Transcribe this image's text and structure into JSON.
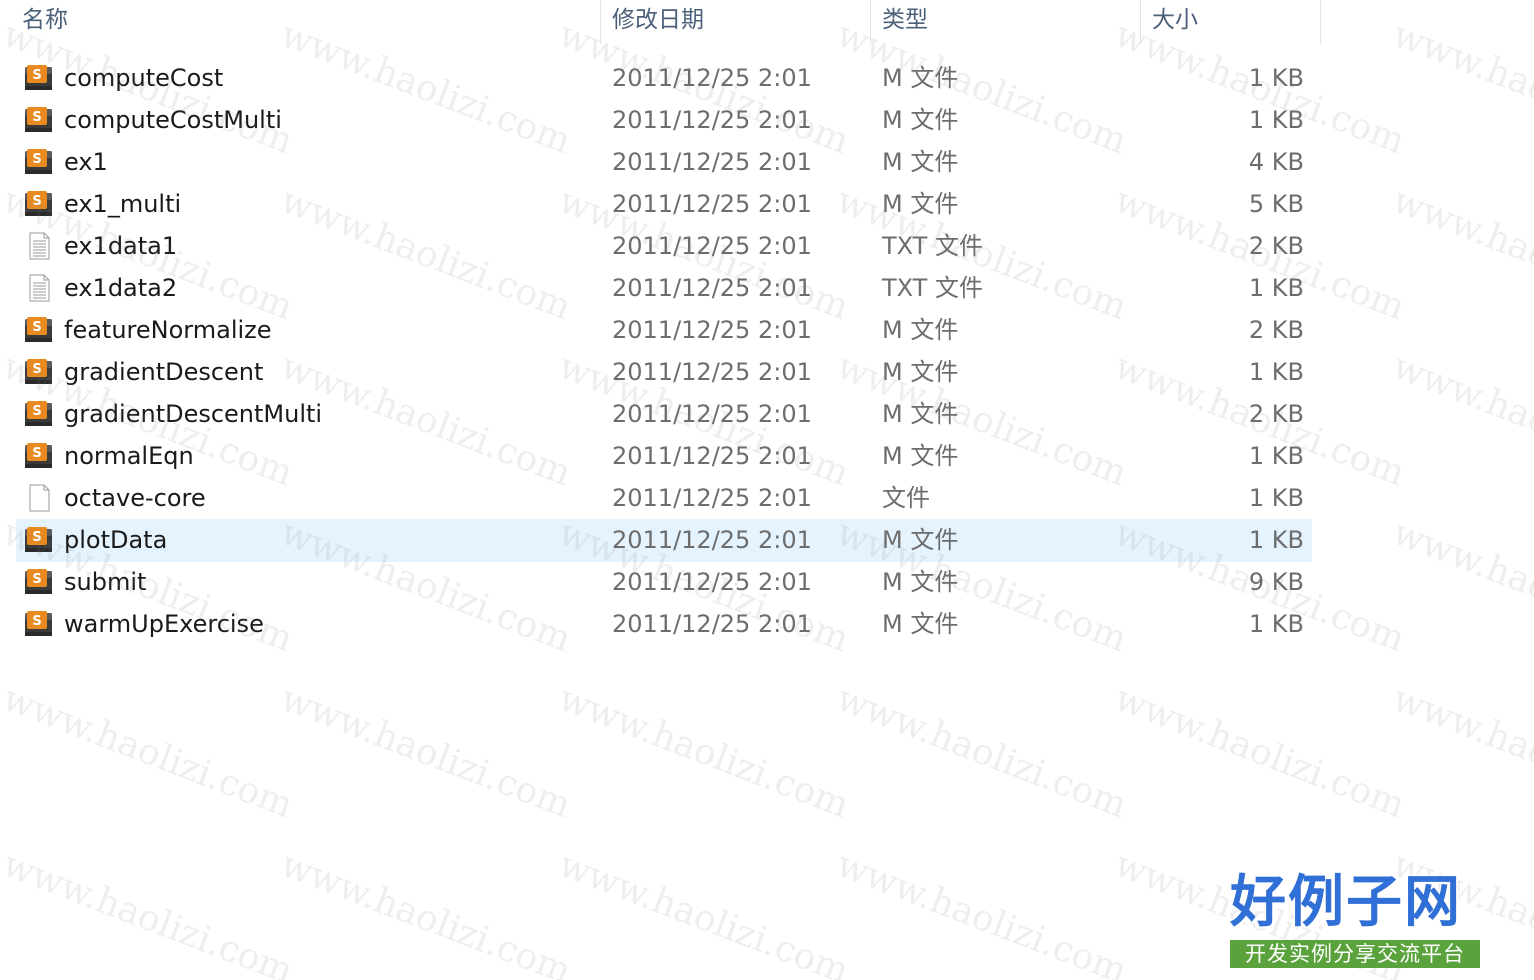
{
  "columns": {
    "name": "名称",
    "date": "修改日期",
    "type": "类型",
    "size": "大小"
  },
  "files": [
    {
      "name": "computeCost",
      "date": "2011/12/25 2:01",
      "type": "M 文件",
      "size": "1 KB",
      "icon": "matlab-file-icon"
    },
    {
      "name": "computeCostMulti",
      "date": "2011/12/25 2:01",
      "type": "M 文件",
      "size": "1 KB",
      "icon": "matlab-file-icon"
    },
    {
      "name": "ex1",
      "date": "2011/12/25 2:01",
      "type": "M 文件",
      "size": "4 KB",
      "icon": "matlab-file-icon"
    },
    {
      "name": "ex1_multi",
      "date": "2011/12/25 2:01",
      "type": "M 文件",
      "size": "5 KB",
      "icon": "matlab-file-icon"
    },
    {
      "name": "ex1data1",
      "date": "2011/12/25 2:01",
      "type": "TXT 文件",
      "size": "2 KB",
      "icon": "text-file-icon"
    },
    {
      "name": "ex1data2",
      "date": "2011/12/25 2:01",
      "type": "TXT 文件",
      "size": "1 KB",
      "icon": "text-file-icon"
    },
    {
      "name": "featureNormalize",
      "date": "2011/12/25 2:01",
      "type": "M 文件",
      "size": "2 KB",
      "icon": "matlab-file-icon"
    },
    {
      "name": "gradientDescent",
      "date": "2011/12/25 2:01",
      "type": "M 文件",
      "size": "1 KB",
      "icon": "matlab-file-icon"
    },
    {
      "name": "gradientDescentMulti",
      "date": "2011/12/25 2:01",
      "type": "M 文件",
      "size": "2 KB",
      "icon": "matlab-file-icon"
    },
    {
      "name": "normalEqn",
      "date": "2011/12/25 2:01",
      "type": "M 文件",
      "size": "1 KB",
      "icon": "matlab-file-icon"
    },
    {
      "name": "octave-core",
      "date": "2011/12/25 2:01",
      "type": "文件",
      "size": "1 KB",
      "icon": "blank-file-icon"
    },
    {
      "name": "plotData",
      "date": "2011/12/25 2:01",
      "type": "M 文件",
      "size": "1 KB",
      "icon": "matlab-file-icon",
      "selected": true
    },
    {
      "name": "submit",
      "date": "2011/12/25 2:01",
      "type": "M 文件",
      "size": "9 KB",
      "icon": "matlab-file-icon"
    },
    {
      "name": "warmUpExercise",
      "date": "2011/12/25 2:01",
      "type": "M 文件",
      "size": "1 KB",
      "icon": "matlab-file-icon"
    }
  ],
  "watermark": "www.haolizi.com",
  "logo": {
    "title": "好例子网",
    "subtitle": "开发实例分享交流平台"
  },
  "colors": {
    "selection": "#e5f3ff",
    "header_text": "#4c607a",
    "logo_blue": "#2f6fd6",
    "logo_green": "#5aa33c"
  }
}
